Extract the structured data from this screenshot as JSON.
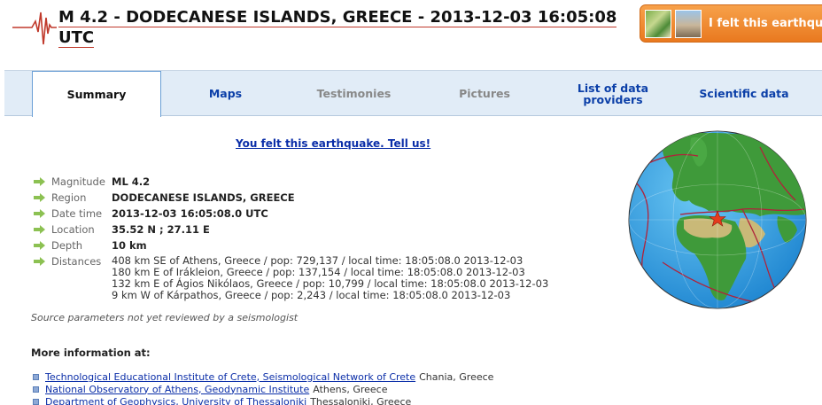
{
  "event": {
    "title": "M 4.2 - DODECANESE ISLANDS, GREECE - 2013-12-03 16:05:08 UTC"
  },
  "felt_button": {
    "label": "I felt this earthquake"
  },
  "tabs": [
    {
      "label": "Summary",
      "state": "active"
    },
    {
      "label": "Maps",
      "state": "enabled"
    },
    {
      "label": "Testimonies",
      "state": "disabled"
    },
    {
      "label": "Pictures",
      "state": "disabled"
    },
    {
      "label": "List of data providers",
      "state": "enabled"
    },
    {
      "label": "Scientific data",
      "state": "enabled"
    }
  ],
  "tell_us_link": "You felt this earthquake. Tell us!",
  "parameters": {
    "magnitude": {
      "label": "Magnitude",
      "value": "ML 4.2"
    },
    "region": {
      "label": "Region",
      "value": "DODECANESE ISLANDS, GREECE"
    },
    "date_time": {
      "label": "Date time",
      "value": "2013-12-03 16:05:08.0 UTC"
    },
    "location": {
      "label": "Location",
      "value": "35.52 N ; 27.11 E"
    },
    "depth": {
      "label": "Depth",
      "value": "10 km"
    },
    "distances": {
      "label": "Distances",
      "lines": [
        "408 km SE of Athens, Greece / pop: 729,137 / local time: 18:05:08.0 2013-12-03",
        "180 km E of Irákleion, Greece / pop: 137,154 / local time: 18:05:08.0 2013-12-03",
        "132 km E of Ágios Nikólaos, Greece / pop: 10,799 / local time: 18:05:08.0 2013-12-03",
        "9 km W of Kárpathos, Greece / pop: 2,243 / local time: 18:05:08.0 2013-12-03"
      ]
    }
  },
  "review_note": "Source parameters not yet reviewed by a seismologist",
  "more_info": {
    "heading": "More information at:",
    "links": [
      {
        "text": "Technological Educational Institute of Crete, Seismological Network of Crete",
        "location": "Chania, Greece"
      },
      {
        "text": "National Observatory of Athens, Geodynamic Institute",
        "location": "Athens, Greece"
      },
      {
        "text": "Department of Geophysics, University of Thessaloniki",
        "location": "Thessaloniki, Greece"
      }
    ]
  },
  "colors": {
    "tab_bg": "#e1ecf7",
    "link": "#0b2ea8",
    "accent_orange": "#e9791f",
    "arrow_green": "#8cc152",
    "ocean": "#3aa8e8",
    "land": "#3f9a3a",
    "plate_boundary": "#b0223a",
    "epicenter": "#e53b1c"
  },
  "icons": {
    "logo": "seismogram-icon",
    "param_bullet": "green-arrow-icon",
    "link_bullet": "square-bullet-icon",
    "epicenter": "star-icon"
  }
}
